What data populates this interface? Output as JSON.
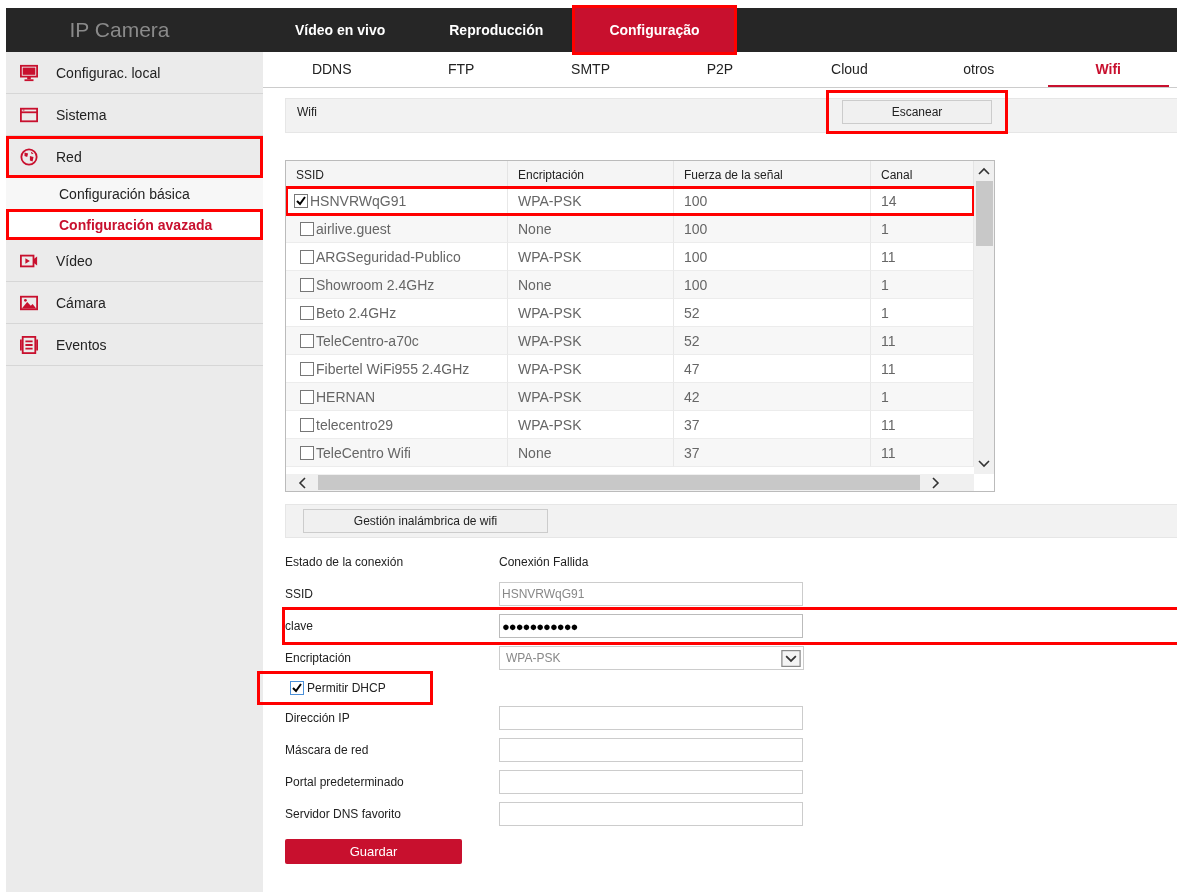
{
  "header": {
    "title": "IP Camera",
    "nav": [
      {
        "label": "Vídeo en vivo",
        "selected": false,
        "highlighted": false
      },
      {
        "label": "Reproducción",
        "selected": false,
        "highlighted": false
      },
      {
        "label": "Configuração",
        "selected": true,
        "highlighted": true
      }
    ]
  },
  "sidebar": {
    "items": [
      {
        "label": "Configurac. local",
        "highlighted": false
      },
      {
        "label": "Sistema",
        "highlighted": false
      },
      {
        "label": "Red",
        "highlighted": true,
        "children": [
          {
            "label": "Configuración básica",
            "selected": false,
            "highlighted": false
          },
          {
            "label": "Configuración avazada",
            "selected": true,
            "highlighted": true
          }
        ]
      },
      {
        "label": "Vídeo",
        "highlighted": false
      },
      {
        "label": "Cámara",
        "highlighted": false
      },
      {
        "label": "Eventos",
        "highlighted": false
      }
    ]
  },
  "subtabs": [
    {
      "label": "DDNS",
      "selected": false
    },
    {
      "label": "FTP",
      "selected": false
    },
    {
      "label": "SMTP",
      "selected": false
    },
    {
      "label": "P2P",
      "selected": false
    },
    {
      "label": "Cloud",
      "selected": false
    },
    {
      "label": "otros",
      "selected": false
    },
    {
      "label": "Wifi",
      "selected": true
    }
  ],
  "wifi_panel": {
    "title": "Wifi",
    "scan_button": {
      "label": "Escanear",
      "highlighted": true
    }
  },
  "table": {
    "columns": [
      "SSID",
      "Encriptación",
      "Fuerza de la señal",
      "Canal"
    ],
    "rows": [
      {
        "checked": true,
        "highlighted": true,
        "cells": [
          "HSNVRWqG91",
          "WPA-PSK",
          "100",
          "14"
        ]
      },
      {
        "checked": false,
        "highlighted": false,
        "cells": [
          "airlive.guest",
          "None",
          "100",
          "1"
        ]
      },
      {
        "checked": false,
        "highlighted": false,
        "cells": [
          "ARGSeguridad-Publico",
          "WPA-PSK",
          "100",
          "11"
        ]
      },
      {
        "checked": false,
        "highlighted": false,
        "cells": [
          "Showroom 2.4GHz",
          "None",
          "100",
          "1"
        ]
      },
      {
        "checked": false,
        "highlighted": false,
        "cells": [
          "Beto 2.4GHz",
          "WPA-PSK",
          "52",
          "1"
        ]
      },
      {
        "checked": false,
        "highlighted": false,
        "cells": [
          "TeleCentro-a70c",
          "WPA-PSK",
          "52",
          "11"
        ]
      },
      {
        "checked": false,
        "highlighted": false,
        "cells": [
          "Fibertel WiFi955 2.4GHz",
          "WPA-PSK",
          "47",
          "11"
        ]
      },
      {
        "checked": false,
        "highlighted": false,
        "cells": [
          "HERNAN",
          "WPA-PSK",
          "42",
          "1"
        ]
      },
      {
        "checked": false,
        "highlighted": false,
        "cells": [
          "telecentro29",
          "WPA-PSK",
          "37",
          "11"
        ]
      },
      {
        "checked": false,
        "highlighted": false,
        "cells": [
          "TeleCentro Wifi",
          "None",
          "37",
          "11"
        ]
      }
    ]
  },
  "manage_button": {
    "label": "Gestión inalámbrica de wifi"
  },
  "form": {
    "rows": [
      {
        "kind": "status",
        "label": "Estado de la conexión",
        "value": "Conexión Fallida",
        "highlighted": false
      },
      {
        "kind": "text",
        "label": "SSID",
        "value": "HSNVRWqG91",
        "highlighted": false
      },
      {
        "kind": "password",
        "label": "clave",
        "value": "●●●●●●●●●●●",
        "highlighted": true
      },
      {
        "kind": "select",
        "label": "Encriptación",
        "value": "WPA-PSK",
        "highlighted": false
      },
      {
        "kind": "checkbox",
        "label": "Permitir DHCP",
        "checked": true,
        "highlighted": true
      },
      {
        "kind": "text",
        "label": "Dirección IP",
        "highlighted": false
      },
      {
        "kind": "text",
        "label": "Máscara de red",
        "highlighted": false
      },
      {
        "kind": "text",
        "label": "Portal predeterminado",
        "highlighted": false
      },
      {
        "kind": "text",
        "label": "Servidor DNS favorito",
        "highlighted": false
      }
    ],
    "save_button": {
      "label": "Guardar"
    }
  }
}
